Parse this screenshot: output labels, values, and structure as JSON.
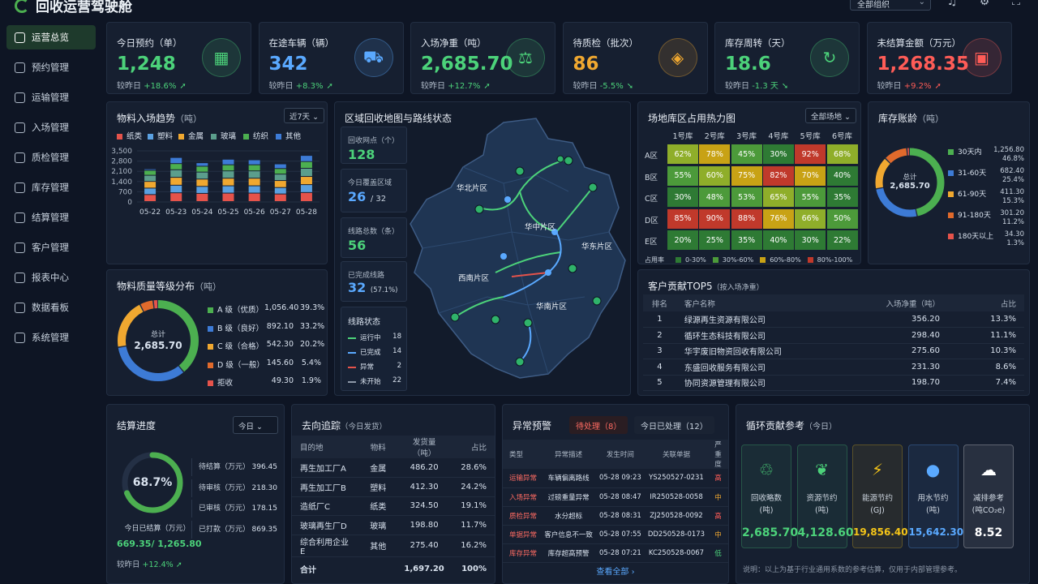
{
  "app": {
    "title": "回收运营驾驶舱",
    "org_select": "全部组织"
  },
  "sidebar": {
    "items": [
      {
        "label": "运营总览",
        "icon": "dashboard-icon",
        "active": true
      },
      {
        "label": "预约管理",
        "icon": "calendar-icon"
      },
      {
        "label": "运输管理",
        "icon": "truck-icon"
      },
      {
        "label": "入场管理",
        "icon": "entry-icon"
      },
      {
        "label": "质检管理",
        "icon": "inspection-icon"
      },
      {
        "label": "库存管理",
        "icon": "warehouse-icon"
      },
      {
        "label": "结算管理",
        "icon": "settlement-icon"
      },
      {
        "label": "客户管理",
        "icon": "customer-icon"
      },
      {
        "label": "报表中心",
        "icon": "report-icon"
      },
      {
        "label": "数据看板",
        "icon": "board-icon"
      },
      {
        "label": "系统管理",
        "icon": "settings-icon"
      }
    ]
  },
  "kpis": [
    {
      "label": "今日预约（单）",
      "value": "1,248",
      "cmp_label": "较昨日",
      "cmp": "+18.6%",
      "dir": "up",
      "color": "#4cd27a",
      "icon": "calendar-icon",
      "glyph": "▦"
    },
    {
      "label": "在途车辆（辆）",
      "value": "342",
      "cmp_label": "较昨日",
      "cmp": "+8.3%",
      "dir": "up",
      "color": "#5aa9ff",
      "icon": "truck-icon",
      "glyph": "⛟"
    },
    {
      "label": "入场净重（吨）",
      "value": "2,685.70",
      "cmp_label": "较昨日",
      "cmp": "+12.7%",
      "dir": "up",
      "color": "#4cd27a",
      "icon": "scale-icon",
      "glyph": "⚖"
    },
    {
      "label": "待质检（批次）",
      "value": "86",
      "cmp_label": "较昨日",
      "cmp": "-5.5%",
      "dir": "down",
      "color": "#f0a830",
      "icon": "shield-icon",
      "glyph": "◈"
    },
    {
      "label": "库存周转（天）",
      "value": "18.6",
      "cmp_label": "较昨日",
      "cmp": "-1.3 天",
      "dir": "down",
      "color": "#4cd27a",
      "icon": "refresh-icon",
      "glyph": "↻"
    },
    {
      "label": "未结算金额（万元）",
      "value": "1,268.35",
      "cmp_label": "较昨日",
      "cmp": "+9.2%",
      "dir": "up",
      "color": "#ff5c57",
      "icon": "wallet-icon",
      "glyph": "▣"
    }
  ],
  "trend": {
    "title": "物料入场趋势",
    "unit": "（吨）",
    "range": "近7天"
  },
  "chart_data": {
    "type": "bar",
    "stacked": true,
    "title": "物料入场趋势（吨）",
    "categories": [
      "05-22",
      "05-23",
      "05-24",
      "05-25",
      "05-26",
      "05-27",
      "05-28"
    ],
    "ylim": [
      0,
      3500
    ],
    "yticks": [
      "3,500",
      "2,800",
      "2,100",
      "1,400",
      "700",
      "0"
    ],
    "series": [
      {
        "name": "纸类",
        "color": "#e5534b",
        "values": [
          480,
          600,
          560,
          580,
          580,
          520,
          620
        ]
      },
      {
        "name": "塑料",
        "color": "#5aa0e0",
        "values": [
          440,
          520,
          480,
          500,
          500,
          440,
          540
        ]
      },
      {
        "name": "金属",
        "color": "#f0a830",
        "values": [
          460,
          540,
          500,
          520,
          520,
          480,
          560
        ]
      },
      {
        "name": "玻璃",
        "color": "#5b9e8c",
        "values": [
          420,
          520,
          480,
          500,
          500,
          440,
          560
        ]
      },
      {
        "name": "纺织",
        "color": "#4caf50",
        "values": [
          340,
          420,
          400,
          420,
          420,
          380,
          460
        ]
      },
      {
        "name": "其他",
        "color": "#3d7bd6",
        "values": [
          100,
          420,
          240,
          380,
          340,
          320,
          420
        ]
      }
    ]
  },
  "quality": {
    "title": "物料质量等级分布",
    "unit": "（吨）",
    "total_label": "总计",
    "total": "2,685.70",
    "items": [
      {
        "name": "A 级（优质）",
        "value": "1,056.40",
        "pct": "39.3%",
        "p": 39.3,
        "color": "#4caf50"
      },
      {
        "name": "B 级（良好）",
        "value": "892.10",
        "pct": "33.2%",
        "p": 33.2,
        "color": "#3d7bd6"
      },
      {
        "name": "C 级（合格）",
        "value": "542.30",
        "pct": "20.2%",
        "p": 20.2,
        "color": "#f0a830"
      },
      {
        "name": "D 级（一般）",
        "value": "145.60",
        "pct": "5.4%",
        "p": 5.4,
        "color": "#e06a2c"
      },
      {
        "name": "拒收",
        "value": "49.30",
        "pct": "1.9%",
        "p": 1.9,
        "color": "#e5534b"
      }
    ]
  },
  "map": {
    "title": "区域回收地图与路线状态",
    "points_label": "回收网点（个）",
    "points": "128",
    "coverage_label": "今日覆盖区域",
    "coverage": "26",
    "coverage_total": "/ 32",
    "lines_label": "线路总数（条）",
    "lines": "56",
    "done_label": "已完成线路",
    "done": "32",
    "done_pct": "(57.1%)",
    "status_title": "线路状态",
    "status": [
      {
        "name": "运行中",
        "count": "18",
        "color": "#4cd27a"
      },
      {
        "name": "已完成",
        "count": "14",
        "color": "#5aa9ff"
      },
      {
        "name": "异常",
        "count": "2",
        "color": "#e5534b"
      },
      {
        "name": "未开始",
        "count": "22",
        "color": "#8d98a8"
      }
    ],
    "regions": [
      "华北片区",
      "华中片区",
      "华东片区",
      "西南片区",
      "华南片区"
    ]
  },
  "heatmap": {
    "title": "场地库区占用热力图",
    "scope": "全部场地",
    "cols": [
      "1号库",
      "2号库",
      "3号库",
      "4号库",
      "5号库",
      "6号库"
    ],
    "rows": [
      {
        "name": "A区",
        "cells": [
          "62%",
          "78%",
          "45%",
          "30%",
          "92%",
          "68%"
        ]
      },
      {
        "name": "B区",
        "cells": [
          "55%",
          "60%",
          "75%",
          "82%",
          "70%",
          "40%"
        ]
      },
      {
        "name": "C区",
        "cells": [
          "30%",
          "48%",
          "53%",
          "65%",
          "55%",
          "35%"
        ]
      },
      {
        "name": "D区",
        "cells": [
          "85%",
          "90%",
          "88%",
          "76%",
          "66%",
          "50%"
        ]
      },
      {
        "name": "E区",
        "cells": [
          "20%",
          "25%",
          "35%",
          "40%",
          "30%",
          "22%"
        ]
      }
    ],
    "legend_title": "占用率",
    "legend": [
      "0-30%",
      "30%-60%",
      "60%-80%",
      "80%-100%"
    ]
  },
  "inventory": {
    "title": "库存账龄",
    "unit": "（吨）",
    "total_label": "总计",
    "total": "2,685.70",
    "items": [
      {
        "name": "30天内",
        "value": "1,256.80",
        "pct": "46.8%",
        "p": 46.8,
        "color": "#4caf50"
      },
      {
        "name": "31-60天",
        "value": "682.40",
        "pct": "25.4%",
        "p": 25.4,
        "color": "#3d7bd6"
      },
      {
        "name": "61-90天",
        "value": "411.30",
        "pct": "15.3%",
        "p": 15.3,
        "color": "#f0a830"
      },
      {
        "name": "91-180天",
        "value": "301.20",
        "pct": "11.2%",
        "p": 11.2,
        "color": "#e06a2c"
      },
      {
        "name": "180天以上",
        "value": "34.30",
        "pct": "1.3%",
        "p": 1.3,
        "color": "#e5534b"
      }
    ]
  },
  "customers": {
    "title": "客户贡献TOP5",
    "subtitle": "（按入场净重）",
    "headers": [
      "排名",
      "客户名称",
      "入场净重（吨）",
      "占比"
    ],
    "rows": [
      [
        "1",
        "绿源再生资源有限公司",
        "356.20",
        "13.3%"
      ],
      [
        "2",
        "循环生态科技有限公司",
        "298.40",
        "11.1%"
      ],
      [
        "3",
        "华宇废旧物资回收有限公司",
        "275.60",
        "10.3%"
      ],
      [
        "4",
        "东盛回收服务有限公司",
        "231.30",
        "8.6%"
      ],
      [
        "5",
        "协同资源管理有限公司",
        "198.70",
        "7.4%"
      ]
    ]
  },
  "settlement": {
    "title": "结算进度",
    "period": "今日",
    "percent": "68.7%",
    "p": 68.7,
    "done_label": "今日已结算（万元）",
    "done": "669.35",
    "total": "/ 1,265.80",
    "cmp_label": "较昨日",
    "cmp": "+12.4%",
    "items": [
      {
        "name": "待结算（万元）",
        "value": "396.45"
      },
      {
        "name": "待审核（万元）",
        "value": "218.30"
      },
      {
        "name": "已审核（万元）",
        "value": "178.15"
      },
      {
        "name": "已打款（万元）",
        "value": "869.35"
      }
    ]
  },
  "flow": {
    "title": "去向追踪",
    "subtitle": "（今日发货）",
    "headers": [
      "目的地",
      "物料",
      "发货量（吨）",
      "占比"
    ],
    "rows": [
      [
        "再生加工厂A",
        "金属",
        "486.20",
        "28.6%"
      ],
      [
        "再生加工厂B",
        "塑料",
        "412.30",
        "24.2%"
      ],
      [
        "造纸厂C",
        "纸类",
        "324.50",
        "19.1%"
      ],
      [
        "玻璃再生厂D",
        "玻璃",
        "198.80",
        "11.7%"
      ],
      [
        "综合利用企业E",
        "其他",
        "275.40",
        "16.2%"
      ]
    ],
    "total": [
      "合计",
      "",
      "1,697.20",
      "100%"
    ]
  },
  "alerts": {
    "title": "异常预警",
    "tab_pending": "待处理（8）",
    "tab_done": "今日已处理（12）",
    "headers": [
      "类型",
      "异常描述",
      "发生时间",
      "关联单据",
      "严重度"
    ],
    "rows": [
      [
        "运输异常",
        "车辆偏离路线",
        "05-28 09:23",
        "YS250527-0231",
        "高"
      ],
      [
        "入场异常",
        "过磅重量异常",
        "05-28 08:47",
        "IR250528-0058",
        "中"
      ],
      [
        "质检异常",
        "水分超标",
        "05-28 08:31",
        "ZJ250528-0092",
        "高"
      ],
      [
        "单据异常",
        "客户信息不一致",
        "05-28 07:55",
        "DD250528-0173",
        "中"
      ],
      [
        "库存异常",
        "库存超高预警",
        "05-28 07:21",
        "KC250528-0067",
        "低"
      ]
    ],
    "view_all": "查看全部"
  },
  "eco": {
    "title": "循环贡献参考",
    "subtitle": "（今日）",
    "items": [
      {
        "label": "回收略数",
        "unit": "(吨)",
        "value": "2,685.70",
        "color": "#4cd27a",
        "icon": "recycle-icon",
        "glyph": "♲"
      },
      {
        "label": "资源节约",
        "unit": "(吨)",
        "value": "4,128.60",
        "color": "#4cd27a",
        "icon": "leaf-icon",
        "glyph": "❦"
      },
      {
        "label": "能源节约",
        "unit": "(GJ)",
        "value": "19,856.40",
        "color": "#f5c518",
        "icon": "lightning-icon",
        "glyph": "⚡"
      },
      {
        "label": "用水节约",
        "unit": "(吨)",
        "value": "15,642.30",
        "color": "#5aa9ff",
        "icon": "water-drop-icon",
        "glyph": "●"
      },
      {
        "label": "减排参考",
        "unit": "(吨CO₂e)",
        "value": "8.52",
        "color": "#ffffff",
        "icon": "cloud-icon",
        "glyph": "☁"
      }
    ],
    "note": "说明：以上为基于行业通用系数的参考估算，仅用于内部管理参考。"
  }
}
